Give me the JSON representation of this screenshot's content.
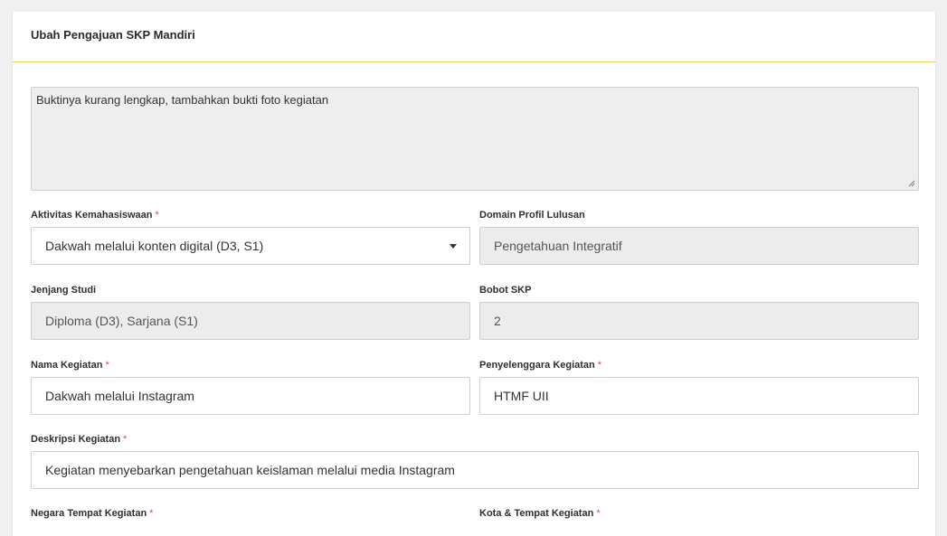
{
  "card": {
    "title": "Ubah Pengajuan SKP Mandiri"
  },
  "notes": {
    "value": "Buktinya kurang lengkap, tambahkan bukti foto kegiatan"
  },
  "fields": {
    "aktivitas": {
      "label": "Aktivitas Kemahasiswaan",
      "required": "*",
      "value": "Dakwah melalui konten digital (D3, S1)"
    },
    "domain": {
      "label": "Domain Profil Lulusan",
      "value": "Pengetahuan Integratif"
    },
    "jenjang": {
      "label": "Jenjang Studi",
      "value": "Diploma (D3), Sarjana (S1)"
    },
    "bobot": {
      "label": "Bobot SKP",
      "value": "2"
    },
    "nama": {
      "label": "Nama Kegiatan",
      "required": "*",
      "value": "Dakwah melalui Instagram"
    },
    "penyelenggara": {
      "label": "Penyelenggara Kegiatan",
      "required": "*",
      "value": "HTMF UII"
    },
    "deskripsi": {
      "label": "Deskripsi Kegiatan",
      "required": "*",
      "value": "Kegiatan menyebarkan pengetahuan keislaman melalui media Instagram"
    },
    "negara": {
      "label": "Negara Tempat Kegiatan",
      "required": "*"
    },
    "kota": {
      "label": "Kota & Tempat Kegiatan",
      "required": "*"
    }
  },
  "icons": {
    "select_caret": "chevron-down-icon",
    "resize_grip": "resize-grip-icon"
  },
  "colors": {
    "header_divider": "#e8cf5a",
    "required_marker": "#e04b4b",
    "readonly_bg": "#ececec"
  }
}
